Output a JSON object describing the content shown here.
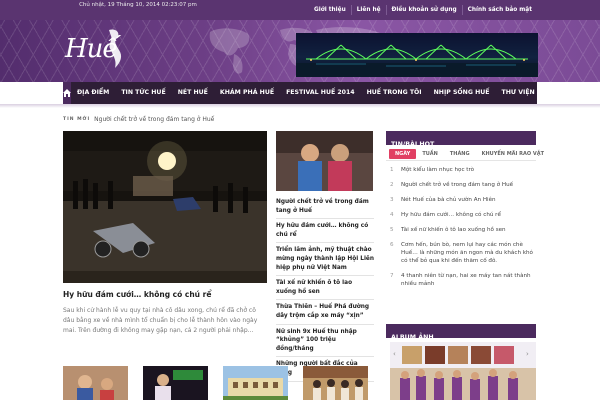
{
  "topbar": {
    "date": "Chủ nhật, 19 Tháng 10, 2014 02:23:07 pm",
    "links": [
      "Giới thiệu",
      "Liên hệ",
      "Điều khoản sử dụng",
      "Chính sách bảo mật"
    ]
  },
  "logo": {
    "text": "Huế"
  },
  "nav": {
    "items": [
      "ĐỊA ĐIỂM",
      "TIN TỨC HUẾ",
      "NÉT HUẾ",
      "KHÁM PHÁ HUẾ",
      "FESTIVAL HUẾ 2014",
      "HUẾ TRONG TÔI",
      "NHỊP SỐNG HUẾ",
      "THƯ VIỆN"
    ]
  },
  "breadcrumb": {
    "tag": "TIN MỚI",
    "text": "Người chết trở về trong đám tang ở Huế"
  },
  "feature": {
    "title": "Hy hữu đám cưới… không có chú rể",
    "desc": "Sau khi cử hành lễ vu quy tại nhà cô dâu xong, chú rể đã chở cô dâu bằng xe về nhà mình tổ chuẩn bị cho lễ thành hôn vào ngày mai. Trên đường đi không may gặp nạn, cả 2 người phải nhập…"
  },
  "middle": {
    "items": [
      "Người chết trở về trong đám tang ở Huế",
      "Hy hữu đám cưới… không có chú rể",
      "Triển lãm ảnh, mỹ thuật chào mừng ngày thành lập Hội Liên hiệp phụ nữ Việt Nam",
      "Tài xế nữ khiến ô tô lao xuống hồ sen",
      "Thừa Thiên – Huế Phá đường dây trộm cắp xe máy “xịn”",
      "Nữ sinh 9x Huế thu nhập “khủng” 100 triệu đồng/tháng",
      "Những người bất đắc của vàng"
    ]
  },
  "sidebar": {
    "heading": "TIN/BÀI HOT",
    "tabs": [
      "NGÀY",
      "TUẦN",
      "THÁNG",
      "KHUYẾN MÃI RAO VẶT"
    ],
    "hot": [
      {
        "n": "1",
        "t": "Một kiểu làm nhục học trò"
      },
      {
        "n": "2",
        "t": "Người chết trở về trong đám tang ở Huế"
      },
      {
        "n": "3",
        "t": "Nét Huế của bà chủ vườn An Hiên"
      },
      {
        "n": "4",
        "t": "Hy hữu đám cưới… không có chú rể"
      },
      {
        "n": "5",
        "t": "Tài xế nữ khiến ô tô lao xuống hồ sen"
      },
      {
        "n": "6",
        "t": "Cơm hến, bún bò, nem lụi hay các món chè Huế… là những món ăn ngon mà du khách khó có thể bỏ qua khi đến thăm cố đô."
      },
      {
        "n": "7",
        "t": "4 thanh niên từ nạn, hai xe máy tan nát thành nhiều mảnh"
      }
    ],
    "album_heading": "ALBUM ẢNH"
  },
  "colors": {
    "brand": "#4b2a5e",
    "accent": "#e13f63",
    "nav": "#2e1e36"
  }
}
